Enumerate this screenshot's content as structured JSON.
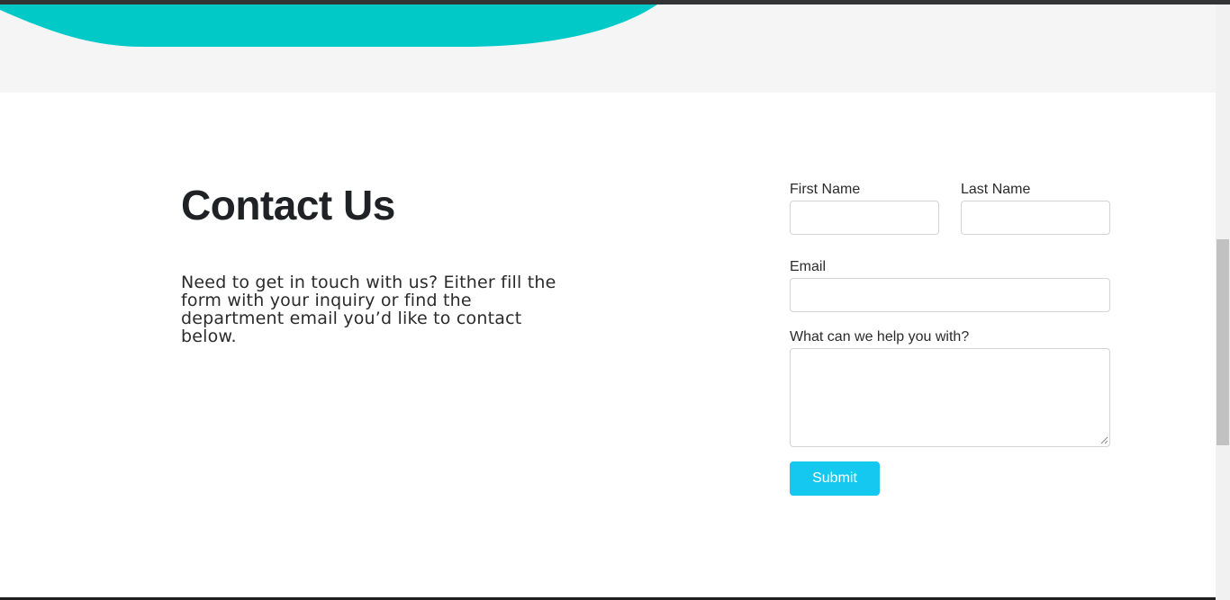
{
  "colors": {
    "accent": "#00c9c8",
    "button": "#14c8ef",
    "hero_bg": "#f5f5f5",
    "text": "#1f2124"
  },
  "contact": {
    "title": "Contact Us",
    "description": "Need to get in touch with us? Either fill the form with your inquiry or find the department email you’d like to contact below."
  },
  "form": {
    "first_name_label": "First Name",
    "first_name_value": "",
    "last_name_label": "Last Name",
    "last_name_value": "",
    "email_label": "Email",
    "email_value": "",
    "message_label": "What can we help you with?",
    "message_value": "",
    "submit_label": "Submit"
  }
}
